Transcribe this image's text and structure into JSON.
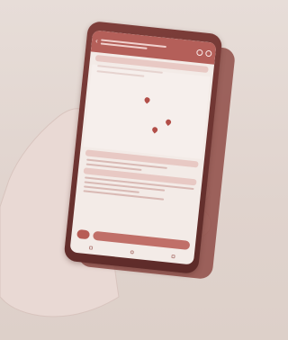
{
  "photo": {
    "subject": "hand-holding-phone",
    "colors": {
      "phone_frame": "#6e3531",
      "screen_bg": "#f3ebe7",
      "header": "#b45f59",
      "pin": "#b24e48",
      "skin": "#e8d7d2"
    }
  }
}
